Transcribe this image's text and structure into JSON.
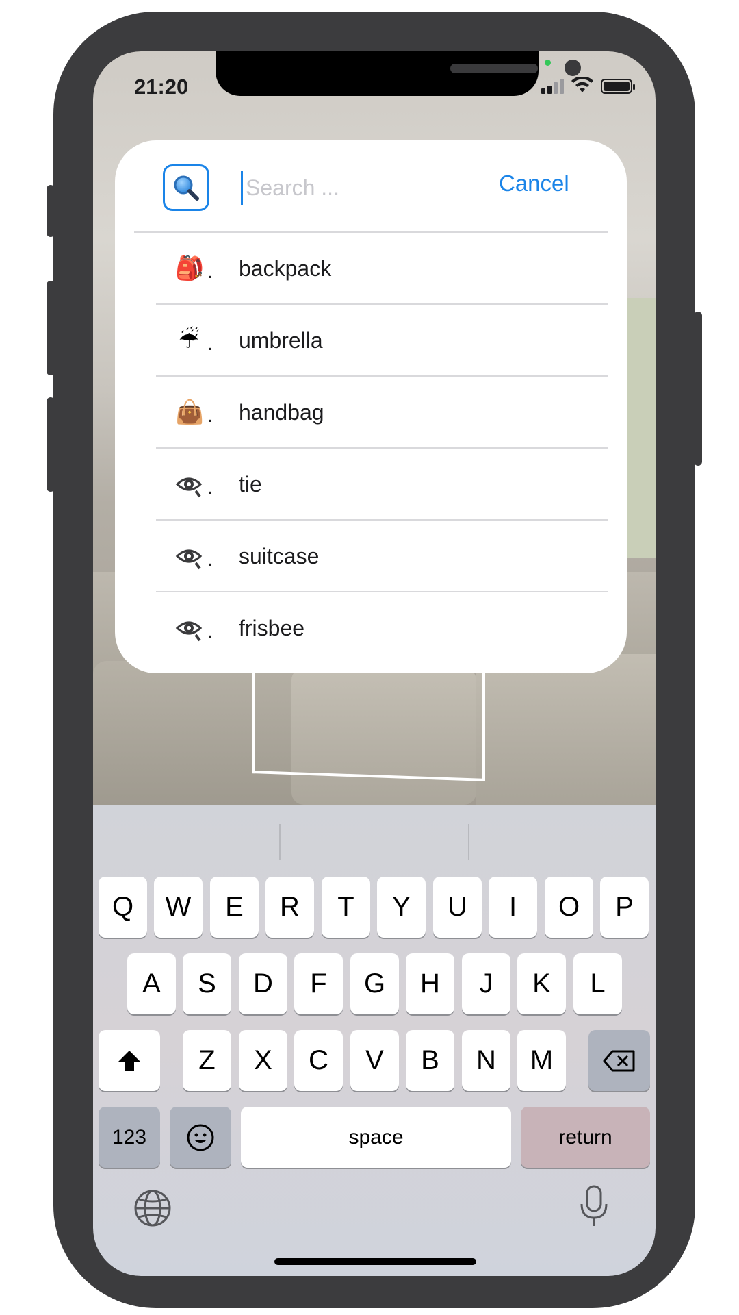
{
  "status": {
    "time": "21:20"
  },
  "search": {
    "placeholder": "Search ...",
    "value": "",
    "cancel_label": "Cancel"
  },
  "results": [
    {
      "icon": "backpack-emoji-icon",
      "glyph": "🎒",
      "label": "backpack"
    },
    {
      "icon": "umbrella-emoji-icon",
      "glyph": "☔",
      "label": "umbrella"
    },
    {
      "icon": "handbag-emoji-icon",
      "glyph": "👜",
      "label": "handbag"
    },
    {
      "icon": "eye-icon",
      "glyph": "👁",
      "label": "tie"
    },
    {
      "icon": "eye-icon",
      "glyph": "👁",
      "label": "suitcase"
    },
    {
      "icon": "eye-icon",
      "glyph": "👁",
      "label": "frisbee"
    }
  ],
  "keyboard": {
    "row1": [
      "Q",
      "W",
      "E",
      "R",
      "T",
      "Y",
      "U",
      "I",
      "O",
      "P"
    ],
    "row2": [
      "A",
      "S",
      "D",
      "F",
      "G",
      "H",
      "J",
      "K",
      "L"
    ],
    "row3": [
      "Z",
      "X",
      "C",
      "V",
      "B",
      "N",
      "M"
    ],
    "numbers_label": "123",
    "space_label": "space",
    "return_label": "return"
  },
  "colors": {
    "accent": "#1a84e8"
  }
}
